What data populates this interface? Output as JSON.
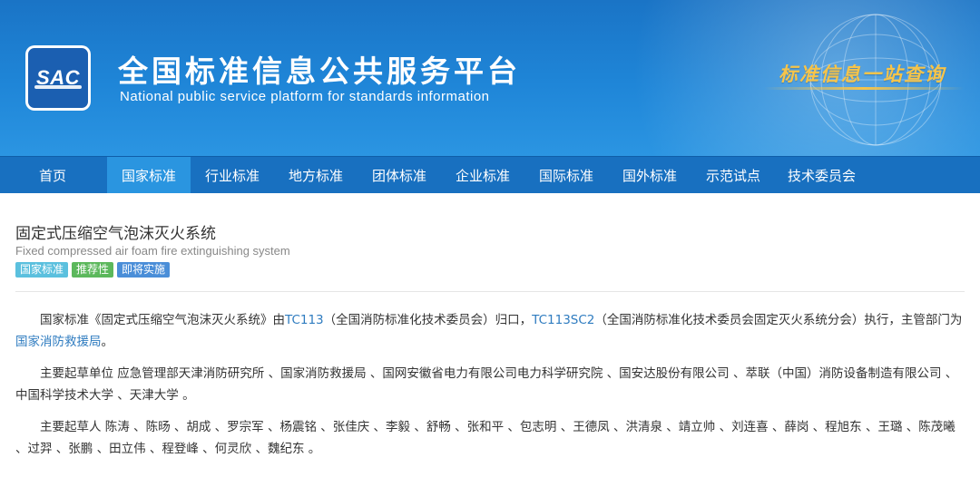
{
  "header": {
    "logo_text": "SAC",
    "title": "全国标准信息公共服务平台",
    "subtitle": "National public service platform  for standards information",
    "slogan": "标准信息一站查询",
    "colors": {
      "banner": "#1f86d8",
      "nav": "#1870c0",
      "nav_active": "#2a95e0",
      "slogan": "#f6c44a"
    }
  },
  "nav": {
    "items": [
      "首页",
      "国家标准",
      "行业标准",
      "地方标准",
      "团体标准",
      "企业标准",
      "国际标准",
      "国外标准",
      "示范试点",
      "技术委员会"
    ],
    "active": "国家标准"
  },
  "standard": {
    "title": "固定式压缩空气泡沫灭火系统",
    "title_en": "Fixed compressed air foam fire extinguishing system",
    "badges": [
      {
        "label": "国家标准",
        "color": "#5bc0de"
      },
      {
        "label": "推荐性",
        "color": "#5cb85c"
      },
      {
        "label": "即将实施",
        "color": "#4a8ed8"
      }
    ]
  },
  "para1": {
    "t1": "国家标准《固定式压缩空气泡沫灭火系统》由",
    "tc": "TC113",
    "t2": "（全国消防标准化技术委员会）归口，",
    "sc": "TC113SC2",
    "t3": "（全国消防标准化技术委员会固定灭火系统分会）执行，主管部门为",
    "dept": "国家消防救援局",
    "t4": "。"
  },
  "para2": "主要起草单位 应急管理部天津消防研究所 、国家消防救援局 、国网安徽省电力有限公司电力科学研究院 、国安达股份有限公司 、萃联（中国）消防设备制造有限公司 、中国科学技术大学 、天津大学 。",
  "para3": "主要起草人 陈涛 、陈旸 、胡成 、罗宗军 、杨震铭 、张佳庆 、李毅 、舒畅 、张和平 、包志明 、王德凤 、洪清泉 、靖立帅 、刘连喜 、薛岗 、程旭东 、王璐 、陈茂曦 、过羿 、张鹏 、田立伟 、程登峰 、何灵欣 、魏纪东 。"
}
